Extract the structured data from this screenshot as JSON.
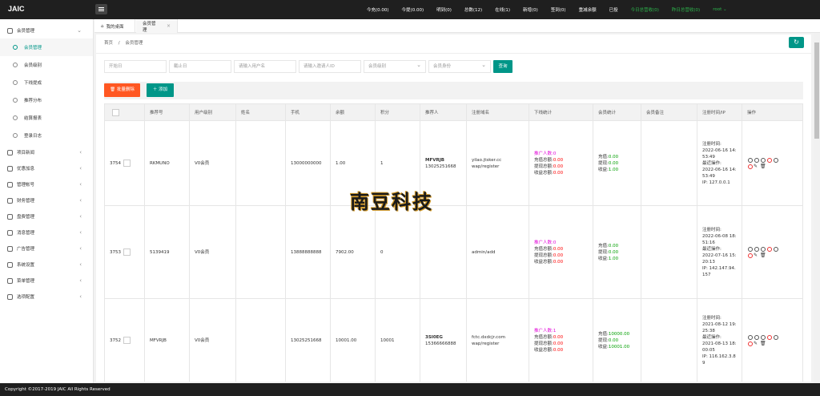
{
  "app": {
    "logo": "JAIC"
  },
  "topnav": [
    {
      "label": "今充(0.00)",
      "green": false
    },
    {
      "label": "今提(0.00)",
      "green": false
    },
    {
      "label": "明到(0)",
      "green": false
    },
    {
      "label": "总数(12)",
      "green": false
    },
    {
      "label": "在线(1)",
      "green": false
    },
    {
      "label": "新增(0)",
      "green": false
    },
    {
      "label": "签到(0)",
      "green": false
    },
    {
      "label": "重减余额",
      "green": false
    },
    {
      "label": "已投",
      "green": false
    },
    {
      "label": "今日总营收(0)",
      "green": true
    },
    {
      "label": "昨日总营收(0)",
      "green": true
    },
    {
      "label": "root ⌄",
      "green": true
    }
  ],
  "sidebar": {
    "group": "会员管理",
    "subitems": [
      "会员管理",
      "会员级别",
      "下线提成",
      "推荐分布",
      "结算报表",
      "登录日志"
    ],
    "items": [
      "项目新闻",
      "优惠加息",
      "管理帐号",
      "财务管理",
      "盘费管理",
      "消息管理",
      "广告管理",
      "系统设置",
      "菜单管理",
      "选项配置"
    ]
  },
  "tabs": {
    "home": "我的桌面",
    "member": "会员管理",
    "close": "×"
  },
  "breadcrumb": {
    "home": "首页",
    "sep": "/",
    "current": "会员管理"
  },
  "filters": {
    "start": "开始日",
    "end": "截止日",
    "username": "请输入用户名",
    "referrer": "请输入邀请人ID",
    "level": "会员级别",
    "identity": "会员身份",
    "search": "查询"
  },
  "toolbar": {
    "batch_delete": "🗑 批量删除",
    "add": "＋ 添加"
  },
  "table": {
    "headers": [
      "",
      "推荐号",
      "用户级别",
      "姓名",
      "手机",
      "余额",
      "积分",
      "推荐人",
      "注册域名",
      "下线统计",
      "会员统计",
      "会员备注",
      "注册时间/IP",
      "操作"
    ],
    "rows": [
      {
        "id": "3754",
        "code": "RKMUNO",
        "level": "V0会员",
        "name": "",
        "phone": "13000000000",
        "balance": "1.00",
        "points": "1",
        "referrer": "MFVRJB",
        "referrer_phone": "13025251668",
        "domain": "yilao.jtsker.cc",
        "domain_path": "wap/register",
        "stat_people": "推广人数:0",
        "stat_charge_label": "充值总额:",
        "stat_charge": "0.00",
        "stat_withdraw_label": "提现总额:",
        "stat_withdraw": "0.00",
        "stat_income_label": "收益总额:",
        "stat_income": "0.00",
        "m_charge_label": "充值:",
        "m_charge": "0.00",
        "m_withdraw_label": "提现:",
        "m_withdraw": "0.00",
        "m_income_label": "收益:",
        "m_income": "1.00",
        "reg_label": "注册时间:",
        "reg_time": "2022-06-16 14:53:49",
        "last_label": "最近操作:",
        "last_time": "2022-06-16 14:53:49",
        "ip": "IP: 127.0.0.1"
      },
      {
        "id": "3753",
        "code": "5139419",
        "level": "V0会员",
        "name": "",
        "phone": "13888888888",
        "balance": "7902.00",
        "points": "0",
        "referrer": "",
        "referrer_phone": "",
        "domain": "admin/add",
        "domain_path": "",
        "stat_people": "推广人数:0",
        "stat_charge_label": "充值总额:",
        "stat_charge": "0.00",
        "stat_withdraw_label": "提现总额:",
        "stat_withdraw": "0.00",
        "stat_income_label": "收益总额:",
        "stat_income": "0.00",
        "m_charge_label": "充值:",
        "m_charge": "0.00",
        "m_withdraw_label": "提现:",
        "m_withdraw": "0.00",
        "m_income_label": "收益:",
        "m_income": "1.00",
        "reg_label": "注册时间:",
        "reg_time": "2022-06-08 18:51:16",
        "last_label": "最近操作:",
        "last_time": "2022-07-16 15:20:13",
        "ip": "IP: 142.147.94.157"
      },
      {
        "id": "3752",
        "code": "MFVRJB",
        "level": "V0会员",
        "name": "",
        "phone": "13025251668",
        "balance": "10001.00",
        "points": "10001",
        "referrer": "3SI0EG",
        "referrer_phone": "15366666888",
        "domain": "fctc.dxdcjr.com",
        "domain_path": "wap/register",
        "stat_people": "推广人数:1",
        "stat_charge_label": "充值总额:",
        "stat_charge": "0.00",
        "stat_withdraw_label": "提现总额:",
        "stat_withdraw": "0.00",
        "stat_income_label": "收益总额:",
        "stat_income": "0.00",
        "m_charge_label": "充值:",
        "m_charge": "10000.00",
        "m_withdraw_label": "提现:",
        "m_withdraw": "0.00",
        "m_income_label": "收益:",
        "m_income": "10001.00",
        "reg_label": "注册时间:",
        "reg_time": "2021-08-12 19:25:38",
        "last_label": "最近操作:",
        "last_time": "2021-08-13 18:00:05",
        "ip": "IP: 116.162.3.89"
      }
    ]
  },
  "watermark": "南豆科技",
  "footer": "Copyright ©2017-2019 JAIC All Rights Reserved",
  "colors": {
    "accent": "#009688",
    "danger": "#ff5722",
    "topbar": "#1f1f1f"
  }
}
